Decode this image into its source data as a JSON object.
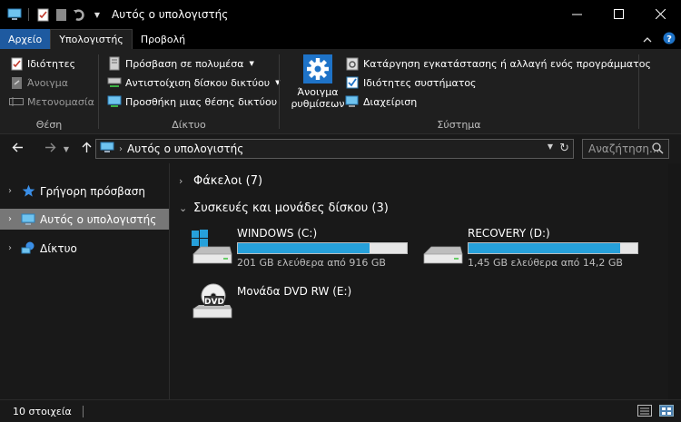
{
  "window": {
    "title": "Αυτός ο υπολογιστής"
  },
  "tabs": [
    {
      "label": "Αρχείο"
    },
    {
      "label": "Υπολογιστής"
    },
    {
      "label": "Προβολή"
    }
  ],
  "ribbon": {
    "location": {
      "label": "Θέση",
      "properties": "Ιδιότητες",
      "open": "Άνοιγμα",
      "rename": "Μετονομασία"
    },
    "network": {
      "label": "Δίκτυο",
      "access_media": "Πρόσβαση σε πολυμέσα",
      "map_drive": "Αντιστοίχιση δίσκου δικτύου",
      "add_location": "Προσθήκη μιας θέσης δικτύου"
    },
    "system": {
      "label": "Σύστημα",
      "open_settings_line1": "Άνοιγμα",
      "open_settings_line2": "ρυθμίσεων",
      "uninstall": "Κατάργηση εγκατάστασης ή αλλαγή ενός προγράμματος",
      "system_properties": "Ιδιότητες συστήματος",
      "manage": "Διαχείριση"
    }
  },
  "address": {
    "path": "Αυτός ο υπολογιστής",
    "search_placeholder": "Αναζήτηση..."
  },
  "sidebar": {
    "items": [
      {
        "label": "Γρήγορη πρόσβαση"
      },
      {
        "label": "Αυτός ο υπολογιστής"
      },
      {
        "label": "Δίκτυο"
      }
    ]
  },
  "content": {
    "folders_header": "Φάκελοι (7)",
    "devices_header": "Συσκευές και μονάδες δίσκου (3)",
    "drives": [
      {
        "name": "WINDOWS (C:)",
        "free": "201 GB ελεύθερα από 916 GB",
        "used_fraction": 0.78
      },
      {
        "name": "RECOVERY (D:)",
        "free": "1,45 GB ελεύθερα από 14,2 GB",
        "used_fraction": 0.9
      },
      {
        "name": "Μονάδα DVD RW (E:)",
        "icon_label": "DVD"
      }
    ]
  },
  "status": {
    "count": "10 στοιχεία"
  }
}
